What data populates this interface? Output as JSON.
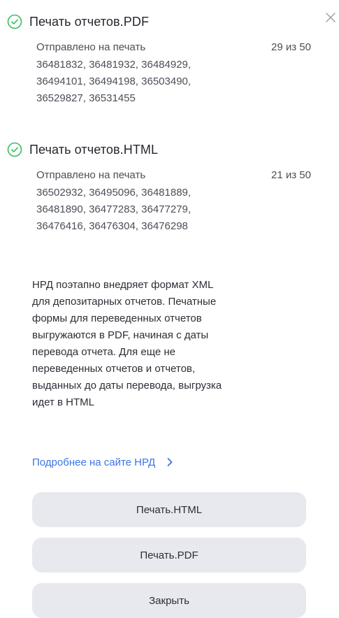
{
  "dialog": {
    "close_icon": "close-icon"
  },
  "pdf_section": {
    "icon": "check-circle-icon",
    "title": "Печать отчетов.PDF",
    "sent_label": "Отправлено на печать",
    "count": "29 из 50",
    "id_lines": [
      "36481832, 36481932, 36484929,",
      "36494101, 36494198, 36503490,",
      "36529827, 36531455"
    ]
  },
  "html_section": {
    "icon": "check-circle-icon",
    "title": "Печать отчетов.HTML",
    "sent_label": "Отправлено на печать",
    "count": "21 из 50",
    "id_lines": [
      "36502932, 36495096, 36481889,",
      "36481890, 36477283, 36477279,",
      "36476416, 36476304, 36476298"
    ]
  },
  "info": {
    "lines": [
      "НРД поэтапно внедряет формат XML",
      "для депозитарных отчетов. Печатные",
      "формы для переведенных отчетов",
      "выгружаются в PDF, начиная с даты",
      "перевода отчета. Для еще не",
      "переведенных отчетов и отчетов,",
      "выданных до даты перевода, выгрузка",
      "идет в HTML"
    ]
  },
  "link": {
    "label": "Подробнее на сайте НРД",
    "icon": "chevron-right-icon"
  },
  "buttons": {
    "print_html": "Печать.HTML",
    "print_pdf": "Печать.PDF",
    "close": "Закрыть"
  },
  "colors": {
    "success": "#3dbb5e",
    "link": "#3b74e6",
    "button_bg": "#e7e9ee"
  }
}
